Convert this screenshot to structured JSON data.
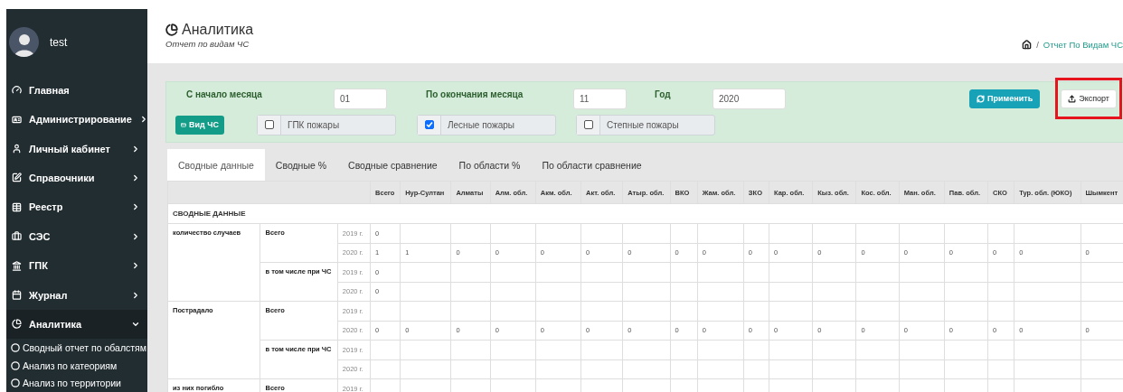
{
  "sidebar": {
    "user": {
      "name": "test"
    },
    "items": [
      {
        "label": "Главная",
        "kind": "link",
        "selected": false
      },
      {
        "label": "Администрирование",
        "kind": "group",
        "expanded": false,
        "selected": false
      },
      {
        "label": "Личный кабинет",
        "kind": "group",
        "expanded": false,
        "selected": false
      },
      {
        "label": "Справочники",
        "kind": "group",
        "expanded": false,
        "selected": false
      },
      {
        "label": "Реестр",
        "kind": "group",
        "expanded": false,
        "selected": false
      },
      {
        "label": "СЭС",
        "kind": "group",
        "expanded": false,
        "selected": false
      },
      {
        "label": "ГПК",
        "kind": "group",
        "expanded": false,
        "selected": false
      },
      {
        "label": "Журнал",
        "kind": "group",
        "expanded": false,
        "selected": false
      },
      {
        "label": "Аналитика",
        "kind": "group",
        "expanded": true,
        "selected": true,
        "children": [
          {
            "label": "Сводный отчет по обалстям"
          },
          {
            "label": "Анализ по катеориям"
          },
          {
            "label": "Анализ по территории"
          }
        ]
      }
    ]
  },
  "page_header": {
    "title": "Аналитика",
    "subtitle": "Отчет по видам ЧС",
    "breadcrumb": [
      {
        "label": "/",
        "kind": "separator"
      },
      {
        "label": "Отчет По Видам ЧС",
        "kind": "link"
      }
    ]
  },
  "filters": {
    "fields": [
      {
        "label": "С начало месяца",
        "value": "01"
      },
      {
        "label": "По окончания месяца",
        "value": "11"
      },
      {
        "label": "Год",
        "value": "2020"
      }
    ],
    "buttons": [
      {
        "label": "Применить",
        "kind": "primary",
        "highlighted": false
      },
      {
        "label": "Экспорт",
        "kind": "default",
        "highlighted": true
      }
    ],
    "type_button": {
      "label": "Вид ЧС"
    },
    "checks": [
      {
        "label": "ГПК пожары",
        "checked": false
      },
      {
        "label": "Лесные пожары",
        "checked": true
      },
      {
        "label": "Степные пожары",
        "checked": false
      }
    ]
  },
  "tabs": [
    {
      "label": "Сводные данные",
      "selected": true
    },
    {
      "label": "Сводные %",
      "selected": false
    },
    {
      "label": "Сводные сравнение",
      "selected": false
    },
    {
      "label": "По области %",
      "selected": false
    },
    {
      "label": "По области сравнение",
      "selected": false
    }
  ],
  "table": {
    "columns": [
      "Всего",
      "Нур-Султан",
      "Алматы",
      "Алм. обл.",
      "Акм. обл.",
      "Акт. обл.",
      "Атыр. обл.",
      "ВКО",
      "Жам. обл.",
      "ЗКО",
      "Кар. обл.",
      "Кыз. обл.",
      "Кос. обл.",
      "Ман. обл.",
      "Пав. обл.",
      "СКО",
      "Тур. обл. (ЮКО)",
      "Шымкент"
    ],
    "section_title": "СВОДНЫЕ ДАННЫЕ",
    "groups": [
      {
        "label": "количество случаев",
        "rows": [
          {
            "label": "Всего",
            "years": [
              {
                "year": "2019 г.",
                "values": [
                  "0"
                ]
              },
              {
                "year": "2020 г.",
                "values": [
                  "1",
                  "1",
                  "0",
                  "0",
                  "0",
                  "0",
                  "0",
                  "0",
                  "0",
                  "0",
                  "0",
                  "0",
                  "0",
                  "0",
                  "0",
                  "0",
                  "0",
                  "0"
                ]
              }
            ]
          },
          {
            "label": "в том числе при ЧС",
            "years": [
              {
                "year": "2019 г.",
                "values": [
                  "0"
                ]
              },
              {
                "year": "2020 г.",
                "values": [
                  "0"
                ]
              }
            ]
          }
        ]
      },
      {
        "label": "Пострадало",
        "rows": [
          {
            "label": "Всего",
            "years": [
              {
                "year": "2019 г."
              },
              {
                "year": "2020 г.",
                "values": [
                  "0",
                  "0",
                  "0",
                  "0",
                  "0",
                  "0",
                  "0",
                  "0",
                  "0",
                  "0",
                  "0",
                  "0",
                  "0",
                  "0",
                  "0",
                  "0",
                  "0",
                  "0"
                ]
              }
            ]
          },
          {
            "label": "в том числе при ЧС",
            "years": [
              {
                "year": "2019 г."
              },
              {
                "year": "2020 г."
              }
            ]
          }
        ]
      },
      {
        "label": "из них погибло",
        "rows": [
          {
            "label": "Всего",
            "years": [
              {
                "year": "2019 г."
              }
            ]
          }
        ]
      }
    ]
  }
}
